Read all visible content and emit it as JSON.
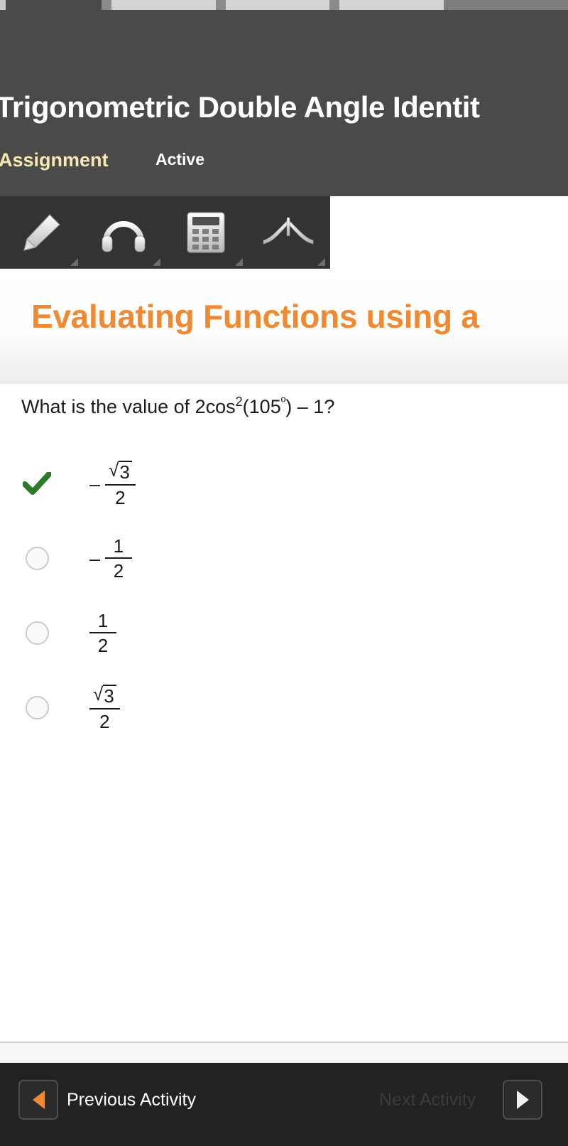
{
  "segment_bar": {
    "name": "lesson-progress-segments",
    "segments": 3
  },
  "header": {
    "title": "Trigonometric Double Angle Identit",
    "activity_type": "Assignment",
    "status": "Active"
  },
  "toolbar": {
    "tools": [
      {
        "label": "Highlighter",
        "icon": "highlighter-icon"
      },
      {
        "label": "Audio",
        "icon": "headphones-icon"
      },
      {
        "label": "Calculator",
        "icon": "calculator-icon"
      },
      {
        "label": "Protractor",
        "icon": "protractor-icon"
      }
    ]
  },
  "banner": {
    "title": "Evaluating Functions using a",
    "color": "#ef8a33"
  },
  "question": {
    "prefix": "What is the value of 2cos",
    "exponent": "2",
    "middle": "(105",
    "degree": "º",
    "suffix": ") – 1?"
  },
  "choices": [
    {
      "id": "choice-a",
      "state": "correct",
      "marker": "check",
      "sign": "–",
      "numerator": "√3",
      "denominator": "2",
      "has_radical": true,
      "text": "–√3/2"
    },
    {
      "id": "choice-b",
      "state": "unselected",
      "marker": "radio",
      "sign": "–",
      "numerator": "1",
      "denominator": "2",
      "has_radical": false,
      "text": "–1/2"
    },
    {
      "id": "choice-c",
      "state": "unselected",
      "marker": "radio",
      "sign": "",
      "numerator": "1",
      "denominator": "2",
      "has_radical": false,
      "text": "1/2"
    },
    {
      "id": "choice-d",
      "state": "unselected",
      "marker": "radio",
      "sign": "",
      "numerator": "√3",
      "denominator": "2",
      "has_radical": true,
      "text": "√3/2"
    }
  ],
  "navbar": {
    "previous_label": "Previous Activity",
    "next_label": "Next Activity",
    "previous_enabled": true,
    "next_enabled": false,
    "previous_arrow_color": "#ef8a33",
    "next_arrow_color": "#f0f0f0"
  }
}
